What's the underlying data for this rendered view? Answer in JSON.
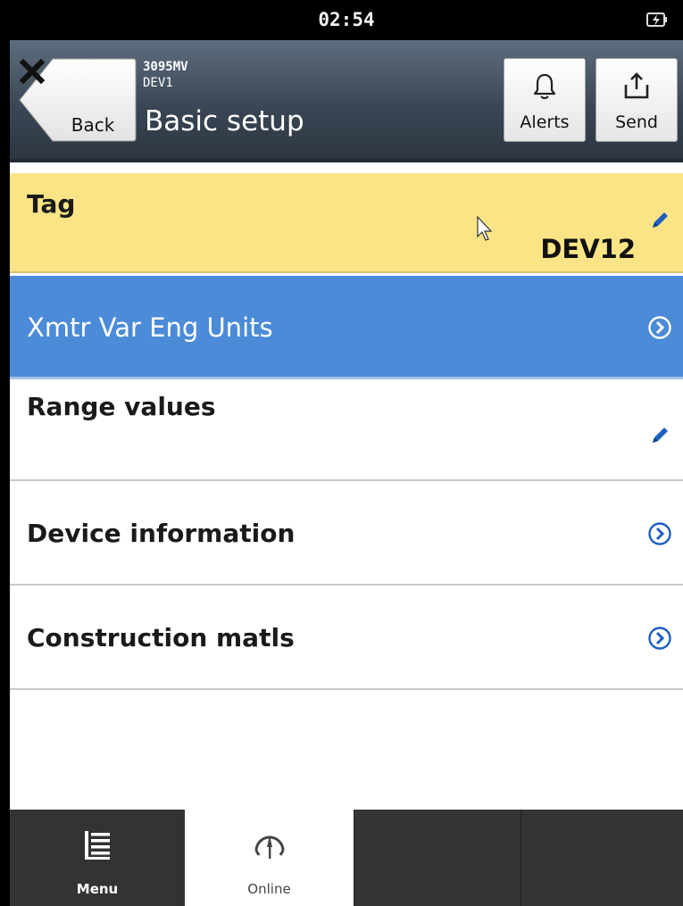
{
  "status_bar": {
    "time": "02:54",
    "battery_icon": "battery-charging-icon"
  },
  "header": {
    "back_label": "Back",
    "device_model": "3095MV",
    "device_tag": "DEV1",
    "title": "Basic setup",
    "alerts_label": "Alerts",
    "send_label": "Send"
  },
  "menu": {
    "items": [
      {
        "label": "Tag",
        "value": "DEV12",
        "action_icon": "pencil-icon",
        "state": "highlighted"
      },
      {
        "label": "Xmtr Var Eng Units",
        "action_icon": "chevron-right-circle-icon",
        "state": "selected"
      },
      {
        "label": "Range values",
        "action_icon": "pencil-icon"
      },
      {
        "label": "Device information",
        "action_icon": "chevron-right-circle-icon"
      },
      {
        "label": "Construction matls",
        "action_icon": "chevron-right-circle-icon"
      }
    ]
  },
  "tabbar": {
    "tabs": [
      {
        "label": "Menu",
        "icon": "menu-list-icon"
      },
      {
        "label": "Online",
        "icon": "online-gauge-icon",
        "active": true
      },
      {
        "label": ""
      },
      {
        "label": ""
      }
    ]
  },
  "colors": {
    "tag_highlight": "#fbe485",
    "selected_row": "#4b8bd7",
    "header_dark": "#3b4756",
    "icon_blue": "#1f5fc2"
  }
}
